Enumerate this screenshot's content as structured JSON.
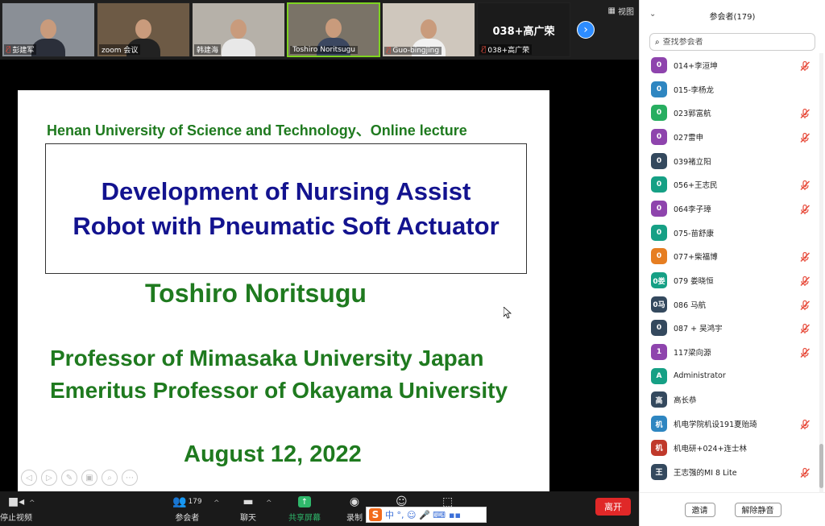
{
  "video_strip": {
    "tiles": [
      {
        "name": "彭建军",
        "muted": true,
        "bg": "#8a8f96",
        "shirt": "#2b2f3a"
      },
      {
        "name": "zoom 会议",
        "muted": false,
        "bg": "#6d5a45",
        "shirt": "#222"
      },
      {
        "name": "韩建海",
        "muted": false,
        "bg": "#b6b1a9",
        "shirt": "#e8e8e8"
      },
      {
        "name": "Toshiro Noritsugu",
        "muted": false,
        "bg": "#7a7367",
        "shirt": "#3b4760"
      },
      {
        "name": "Guo-bingjing",
        "muted": true,
        "bg": "#cfc7bd",
        "shirt": "#f1f1f1"
      }
    ],
    "text_tile": {
      "big": "038+高广荣",
      "label": "038+高广荣",
      "muted": true
    },
    "view_label": "视图",
    "next_icon": "›"
  },
  "slide": {
    "affiliation": "Henan University of Science and Technology、Online lecture",
    "title_line1": "Development of Nursing Assist",
    "title_line2": "Robot with Pneumatic Soft Actuator",
    "author": "Toshiro Noritsugu",
    "position1": "Professor of Mimasaka University Japan",
    "position2": "Emeritus Professor of Okayama University",
    "date": "August 12, 2022"
  },
  "toolbar": {
    "stop_video": "停止视频",
    "participants_label": "参会者",
    "participants_count": "179",
    "chat_label": "聊天",
    "share_label": "共享屏幕",
    "record_label": "录制",
    "leave_label": "离开",
    "ime_chars": "中 °, ☺ 🎤 ⌨"
  },
  "panel": {
    "title": "参会者(179)",
    "search_placeholder": "查找参会者",
    "invite_label": "邀请",
    "unmute_all_label": "解除静音",
    "participants": [
      {
        "avatar": "0",
        "name": "014+李洹坤",
        "color": "#8e44ad",
        "muted": true
      },
      {
        "avatar": "0",
        "name": "015-李杨龙",
        "color": "#2e86c1",
        "muted": false
      },
      {
        "avatar": "0",
        "name": "023郭富航",
        "color": "#27ae60",
        "muted": true
      },
      {
        "avatar": "0",
        "name": "027雷申",
        "color": "#8e44ad",
        "muted": true
      },
      {
        "avatar": "0",
        "name": "039褚立阳",
        "color": "#34495e",
        "muted": false
      },
      {
        "avatar": "0",
        "name": "056+王志民",
        "color": "#16a085",
        "muted": true
      },
      {
        "avatar": "0",
        "name": "064李子璋",
        "color": "#8e44ad",
        "muted": true
      },
      {
        "avatar": "0",
        "name": "075-苗舒康",
        "color": "#16a085",
        "muted": false
      },
      {
        "avatar": "0",
        "name": "077+柴福博",
        "color": "#e67e22",
        "muted": true
      },
      {
        "avatar": "0娄",
        "name": "079 娄晓恒",
        "color": "#16a085",
        "muted": true
      },
      {
        "avatar": "0马",
        "name": "086  马航",
        "color": "#34495e",
        "muted": true
      },
      {
        "avatar": "0",
        "name": "087 + 吴鸿宇",
        "color": "#34495e",
        "muted": true
      },
      {
        "avatar": "1",
        "name": "117梁向源",
        "color": "#8e44ad",
        "muted": true
      },
      {
        "avatar": "A",
        "name": "Administrator",
        "color": "#16a085",
        "muted": false
      },
      {
        "avatar": "高",
        "name": "高长恭",
        "color": "#34495e",
        "muted": false
      },
      {
        "avatar": "机",
        "name": "机电学院机设191夏贻琦",
        "color": "#2e86c1",
        "muted": true
      },
      {
        "avatar": "机",
        "name": "机电研+024+连士林",
        "color": "#c0392b",
        "muted": false
      },
      {
        "avatar": "王",
        "name": "王志强的MI 8 Lite",
        "color": "#34495e",
        "muted": true
      }
    ]
  }
}
